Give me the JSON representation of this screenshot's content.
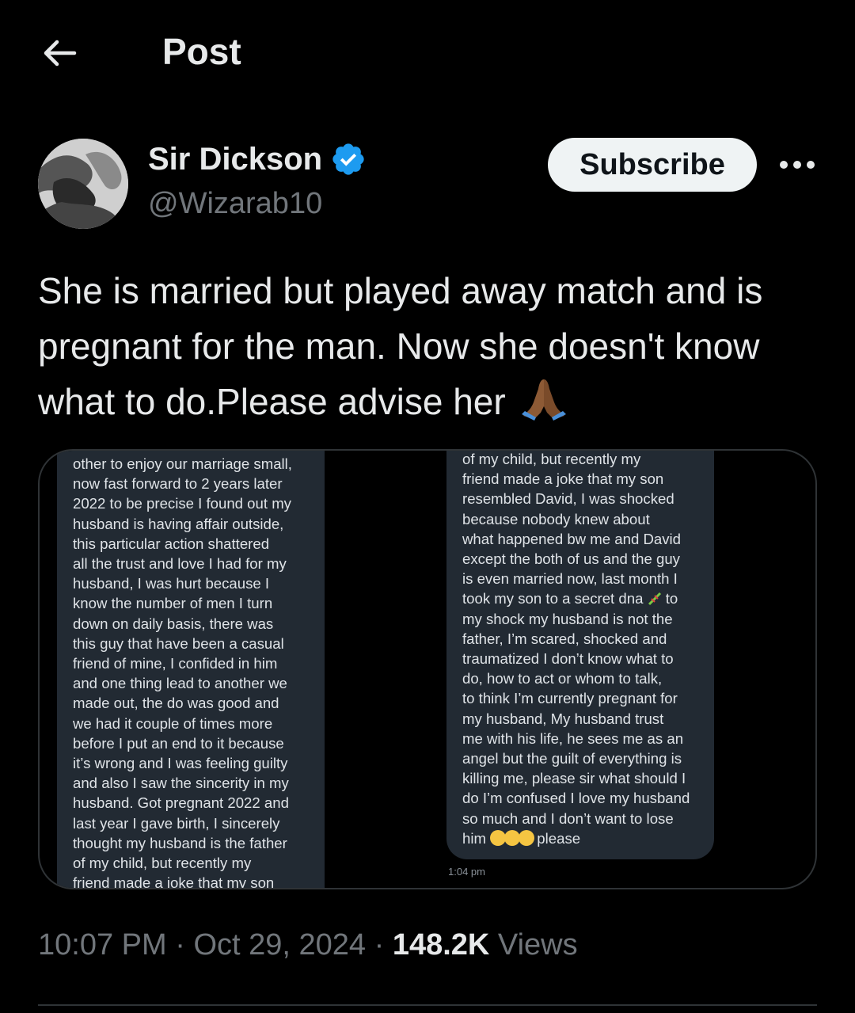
{
  "header": {
    "title": "Post",
    "back_icon": "arrow-left-icon"
  },
  "author": {
    "name": "Sir Dickson",
    "handle": "@Wizarab10",
    "verified_icon": "verified-badge-icon",
    "verified_color": "#1d9bf0"
  },
  "actions": {
    "subscribe_label": "Subscribe",
    "more_icon": "more-horizontal-icon"
  },
  "post": {
    "text": "She is married but played away match and is pregnant for the man. Now she doesn't know what to do.Please advise her",
    "emoji": "folded-hands-icon"
  },
  "screenshot": {
    "left_message": "other to enjoy our marriage small,\nnow fast forward to 2 years later\n2022 to be precise I found out my\nhusband is having affair outside,\nthis particular action shattered\nall the trust and love I had for my\nhusband, I was hurt because I\nknow the number of men I turn\ndown on daily basis, there was\nthis guy that have been a casual\nfriend of mine, I confided in him\nand one thing lead to another we\nmade out, the do was good and\nwe had it couple of times more\nbefore I put an end to it because\nit’s wrong and I was feeling guilty\nand also I saw the sincerity in my\nhusband. Got pregnant 2022 and\nlast year I gave birth, I sincerely\nthought my husband is the father\nof my child, but recently my\nfriend made a joke that my son",
    "right_message_a": "of my child, but recently my\nfriend made a joke that my son\nresembled David,  I was shocked\nbecause nobody knew about\nwhat happened bw me and David\nexcept the both of us and the guy\nis even married now, last month I\ntook my son to a secret dna",
    "right_message_b": " to\nmy shock my husband is not the\nfather, I’m scared, shocked and\ntraumatized I don’t know what to\ndo, how to act or whom to talk,\nto think I’m currently pregnant for\nmy husband, My husband trust\nme with his life, he sees me as an\nangel but the guilt of everything is\nkilling me, please sir what should I\ndo I’m confused I love my husband\nso much and I don’t want to lose\nhim",
    "right_message_end": " please",
    "dna_icon": "dna-icon",
    "crying_icon": "crying-face-icon",
    "time": "1:04 pm"
  },
  "meta": {
    "time": "10:07 PM",
    "sep1": " · ",
    "date": "Oct 29, 2024",
    "sep2": " · ",
    "views_count": "148.2K",
    "views_label": " Views"
  },
  "colors": {
    "background": "#000000",
    "text_primary": "#e7e9ea",
    "text_secondary": "#71767b",
    "bubble": "#222a33"
  }
}
